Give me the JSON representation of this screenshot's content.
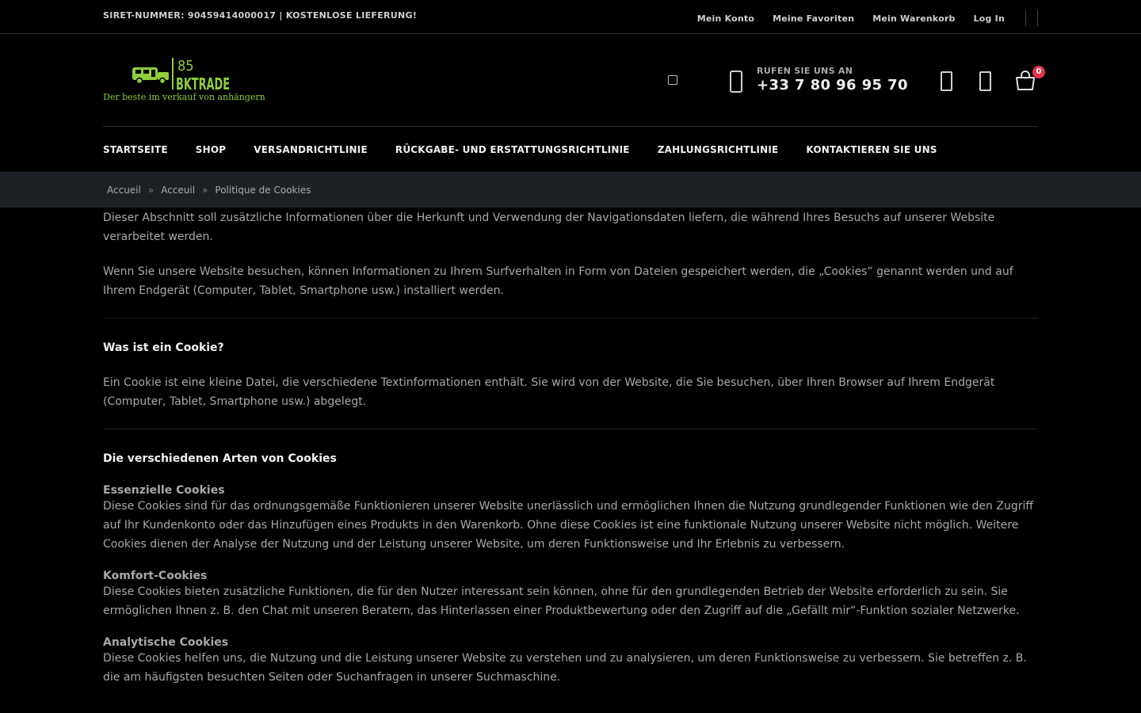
{
  "topbar": {
    "notice": "SIRET-NUMMER: 90459414000017 | KOSTENLOSE LIEFERUNG!",
    "links": [
      "Mein Konto",
      "Meine Favoriten",
      "Mein Warenkorb",
      "Log In"
    ]
  },
  "header": {
    "logo": {
      "number": "85",
      "brand": "BKTRADE",
      "tagline": "Der beste im verkauf von anhängern"
    },
    "phone_label": "RUFEN SIE UNS AN",
    "phone_number": "+33 7 80 96 95 70",
    "cart_count": "0"
  },
  "nav": {
    "items": [
      "STARTSEITE",
      "SHOP",
      "VERSANDRICHTLINIE",
      "RÜCKGABE- UND ERSTATTUNGSRICHTLINIE",
      "ZAHLUNGSRICHTLINIE",
      "KONTAKTIEREN SIE UNS"
    ]
  },
  "breadcrumb": {
    "items": [
      "Accueil",
      "Acceuil",
      "Politique de Cookies"
    ],
    "separator": "»"
  },
  "content": {
    "intro1": "Dieser Abschnitt soll zusätzliche Informationen über die Herkunft und Verwendung der Navigationsdaten liefern, die während Ihres Besuchs auf unserer Website verarbeitet werden.",
    "intro2": "Wenn Sie unsere Website besuchen, können Informationen zu Ihrem Surfverhalten in Form von Dateien gespeichert werden, die „Cookies“ genannt werden und auf Ihrem Endgerät (Computer, Tablet, Smartphone usw.) installiert werden.",
    "h_what": "Was ist ein Cookie?",
    "p_what": "Ein Cookie ist eine kleine Datei, die verschiedene Textinformationen enthält. Sie wird von der Website, die Sie besuchen, über Ihren Browser auf Ihrem Endgerät (Computer, Tablet, Smartphone usw.) abgelegt.",
    "h_types": "Die verschiedenen Arten von Cookies",
    "essential_title": "Essenzielle Cookies",
    "essential_text": "Diese Cookies sind für das ordnungsgemäße Funktionieren unserer Website unerlässlich und ermöglichen Ihnen die Nutzung grundlegender Funktionen wie den Zugriff auf Ihr Kundenkonto oder das Hinzufügen eines Produkts in den Warenkorb. Ohne diese Cookies ist eine funktionale Nutzung unserer Website nicht möglich. Weitere Cookies dienen der Analyse der Nutzung und der Leistung unserer Website, um deren Funktionsweise und Ihr Erlebnis zu verbessern.",
    "comfort_title": "Komfort-Cookies",
    "comfort_text": "Diese Cookies bieten zusätzliche Funktionen, die für den Nutzer interessant sein können, ohne für den grundlegenden Betrieb der Website erforderlich zu sein. Sie ermöglichen Ihnen z. B. den Chat mit unseren Beratern, das Hinterlassen einer Produktbewertung oder den Zugriff auf die „Gefällt mir“-Funktion sozialer Netzwerke.",
    "analytic_title": "Analytische Cookies",
    "analytic_text": "Diese Cookies helfen uns, die Nutzung und die Leistung unserer Website zu verstehen und zu analysieren, um deren Funktionsweise zu verbessern. Sie betreffen z. B. die am häufigsten besuchten Seiten oder Suchanfragen in unserer Suchmaschine."
  },
  "colors": {
    "accent_green": "#8fce3a",
    "badge_red": "#e8344a",
    "background": "#000000"
  }
}
